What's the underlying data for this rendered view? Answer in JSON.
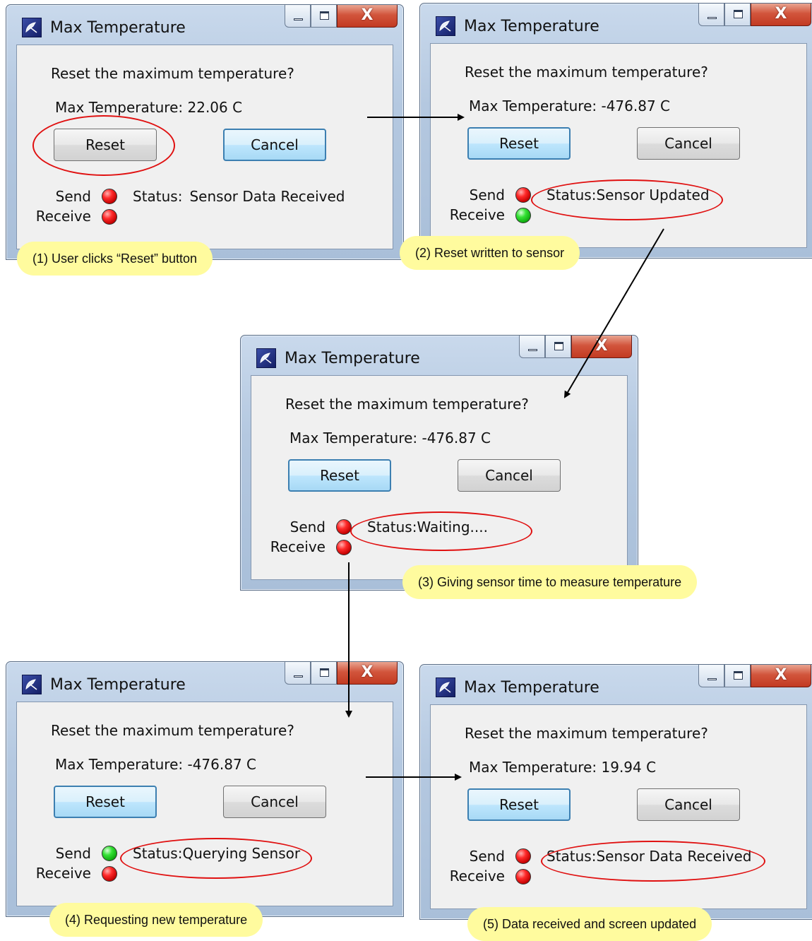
{
  "windows": [
    {
      "title": "Max Temperature",
      "prompt": "Reset the maximum temperature?",
      "max_temp": "Max Temperature: 22.06 C",
      "reset_label": "Reset",
      "cancel_label": "Cancel",
      "send_label": "Send",
      "receive_label": "Receive",
      "status_prefix": "Status:",
      "status_value": "Sensor Data Received",
      "send_led": "red",
      "receive_led": "red",
      "focused_button": "cancel",
      "caption": "(1) User clicks “Reset” button"
    },
    {
      "title": "Max Temperature",
      "prompt": "Reset the maximum temperature?",
      "max_temp": "Max Temperature: -476.87 C",
      "reset_label": "Reset",
      "cancel_label": "Cancel",
      "send_label": "Send",
      "receive_label": "Receive",
      "status_prefix": "Status:",
      "status_value": "Sensor Updated",
      "send_led": "red",
      "receive_led": "green",
      "focused_button": "reset",
      "caption": "(2) Reset written to sensor"
    },
    {
      "title": "Max Temperature",
      "prompt": "Reset the maximum temperature?",
      "max_temp": "Max Temperature: -476.87 C",
      "reset_label": "Reset",
      "cancel_label": "Cancel",
      "send_label": "Send",
      "receive_label": "Receive",
      "status_prefix": "Status:",
      "status_value": "Waiting....",
      "send_led": "red",
      "receive_led": "red",
      "focused_button": "reset",
      "caption": "(3) Giving sensor time to measure temperature"
    },
    {
      "title": "Max Temperature",
      "prompt": "Reset the maximum temperature?",
      "max_temp": "Max Temperature: -476.87 C",
      "reset_label": "Reset",
      "cancel_label": "Cancel",
      "send_label": "Send",
      "receive_label": "Receive",
      "status_prefix": "Status:",
      "status_value": "Querying Sensor",
      "send_led": "green",
      "receive_led": "red",
      "focused_button": "reset",
      "caption": "(4) Requesting new temperature"
    },
    {
      "title": "Max Temperature",
      "prompt": "Reset the maximum temperature?",
      "max_temp": "Max Temperature: 19.94 C",
      "reset_label": "Reset",
      "cancel_label": "Cancel",
      "send_label": "Send",
      "receive_label": "Receive",
      "status_prefix": "Status:",
      "status_value": "Sensor Data Received",
      "send_led": "red",
      "receive_led": "red",
      "focused_button": "reset",
      "caption": "(5) Data received and screen updated"
    }
  ],
  "icons": {
    "window_icon": "satellite-dish-icon",
    "minimize": "minimize-icon",
    "maximize": "maximize-icon",
    "close": "close-icon",
    "close_glyph": "X"
  },
  "colors": {
    "highlight_ring": "#e01010",
    "caption_bg": "#fffb9e",
    "led_red": "#ff2a2a",
    "led_green": "#34e234",
    "focus_border": "#3c7fb1"
  }
}
